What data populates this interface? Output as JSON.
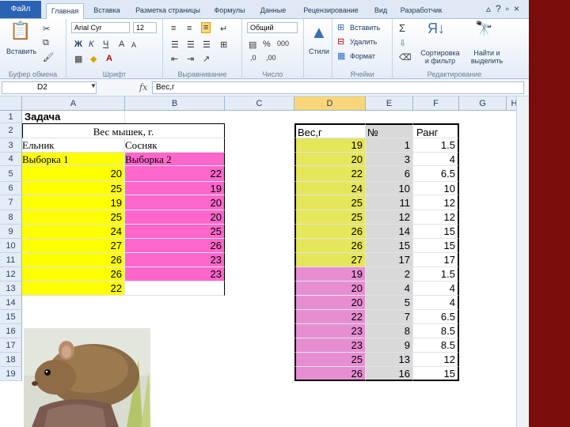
{
  "tabs": {
    "file": "Файл",
    "items": [
      "Главная",
      "Вставка",
      "Разметка страницы",
      "Формулы",
      "Данные",
      "Рецензирование",
      "Вид",
      "Разработчик"
    ],
    "active_index": 0
  },
  "ribbon": {
    "clipboard": {
      "paste": "Вставить",
      "label": "Буфер обмена"
    },
    "font": {
      "name": "Arial Cyr",
      "size": "12",
      "bold": "Ж",
      "italic": "К",
      "underline": "Ч",
      "label": "Шрифт"
    },
    "alignment": {
      "label": "Выравнивание"
    },
    "number": {
      "format": "Общий",
      "label": "Число"
    },
    "styles": {
      "button": "Стили"
    },
    "cells": {
      "insert": "Вставить",
      "delete": "Удалить",
      "format": "Формат",
      "label": "Ячейки"
    },
    "editing": {
      "sort": "Сортировка и фильтр",
      "find": "Найти и выделить",
      "label": "Редактирование"
    }
  },
  "formula_bar": {
    "name_box": "D2",
    "fx": "fx",
    "content": "Вес,г"
  },
  "columns": [
    "A",
    "B",
    "C",
    "D",
    "E",
    "F",
    "G",
    "H"
  ],
  "selected_column": "D",
  "rows": [
    "1",
    "2",
    "3",
    "4",
    "5",
    "6",
    "7",
    "8",
    "9",
    "10",
    "11",
    "12",
    "13",
    "14",
    "15",
    "16",
    "17",
    "18",
    "19"
  ],
  "sheet": {
    "a1": "Задача",
    "b2": "Вес мышек, г.",
    "a3": "Ельник",
    "b3": "Сосняк",
    "a4": "Выборка 1",
    "b4": "Выборка 2",
    "sample1": [
      20,
      25,
      19,
      25,
      24,
      27,
      26,
      26,
      22
    ],
    "sample2": [
      22,
      19,
      20,
      20,
      25,
      26,
      23,
      23
    ],
    "d2": "Вес,г",
    "e2": "№",
    "f2": "Ранг",
    "weights": [
      19,
      20,
      22,
      24,
      25,
      25,
      26,
      26,
      27,
      19,
      20,
      20,
      22,
      23,
      23,
      25,
      26
    ],
    "numbers": [
      1,
      3,
      6,
      10,
      11,
      12,
      14,
      15,
      17,
      2,
      4,
      5,
      7,
      8,
      9,
      13,
      16
    ],
    "ranks": [
      "1.5",
      "4",
      "6.5",
      "10",
      "12",
      "12",
      "15",
      "15",
      "17",
      "1.5",
      "4",
      "4",
      "6.5",
      "8.5",
      "8.5",
      "12",
      "15"
    ]
  },
  "colors": {
    "yellow": "#ffff00",
    "pink": "#ff66cc",
    "file_tab": "#2a62b4",
    "slide_bg": "#7a0c0c"
  }
}
